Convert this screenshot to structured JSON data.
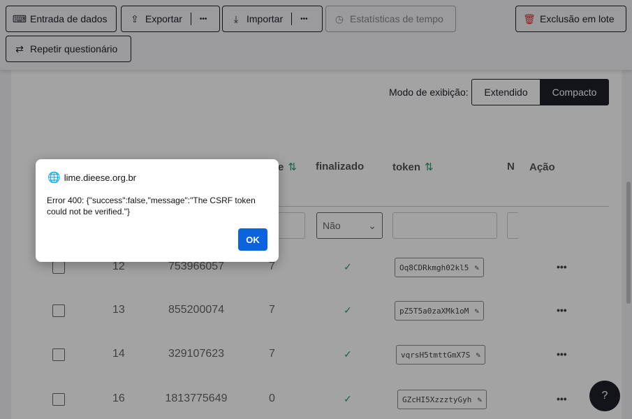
{
  "toolbar": {
    "data_entry": "Entrada de dados",
    "export": "Exportar",
    "import": "Importar",
    "more": "•••",
    "time_stats": "Estatísticas de tempo",
    "batch_delete": "Exclusão em lote",
    "repeat": "Repetir questionário"
  },
  "view_mode": {
    "label": "Modo de exibição:",
    "extended": "Extendido",
    "compact": "Compacto"
  },
  "table": {
    "headers": {
      "lastpage": "e",
      "finalizado": "finalizado",
      "token": "token",
      "n": "N",
      "acao": "Ação"
    },
    "sort_icon": "⇅",
    "filter_finalizado": "Não",
    "rows": [
      {
        "id": "12",
        "seed": "753966057",
        "lastpage": "7",
        "token": "Oq8CDRkmgh02kl5"
      },
      {
        "id": "13",
        "seed": "855200074",
        "lastpage": "7",
        "token": "pZ5T5a0zaXMk1oM"
      },
      {
        "id": "14",
        "seed": "329107623",
        "lastpage": "7",
        "token": "vqrsH5tmttGmX7S"
      },
      {
        "id": "16",
        "seed": "1813775649",
        "lastpage": "0",
        "token": "GZcHI5XzzztyGyh"
      }
    ],
    "action": "•••"
  },
  "dialog": {
    "origin": "lime.dieese.org.br",
    "message": "Error 400: {\"success\":false,\"message\":\"The CSRF token could not be verified.\"}",
    "ok": "OK"
  },
  "colors": {
    "accent": "#0b64dd",
    "dark": "#1e1e2a",
    "success": "#2c9c6a",
    "danger": "#d9302f"
  }
}
